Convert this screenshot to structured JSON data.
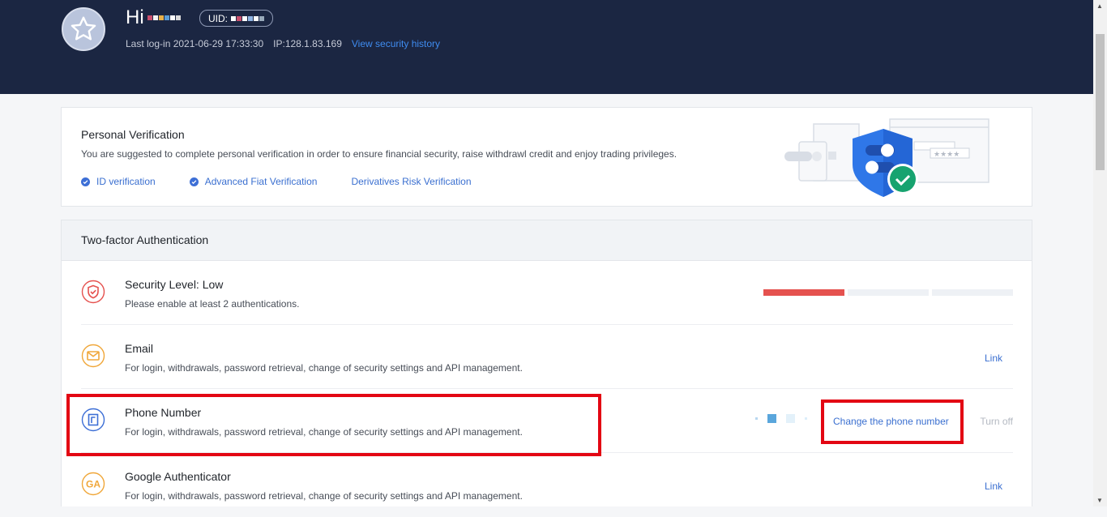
{
  "header": {
    "greeting": "Hi",
    "uid_label": "UID:",
    "last_login_label": "Last log-in 2021-06-29 17:33:30",
    "ip_label": "IP:128.1.83.169",
    "security_history_link": "View security history"
  },
  "personal_verification": {
    "title": "Personal Verification",
    "description": "You are suggested to complete personal verification in order to ensure financial security, raise withdrawl credit and enjoy trading privileges.",
    "links": [
      {
        "label": "ID verification",
        "completed": true
      },
      {
        "label": "Advanced Fiat Verification",
        "completed": true
      },
      {
        "label": "Derivatives Risk Verification",
        "completed": false
      }
    ]
  },
  "two_factor": {
    "title": "Two-factor Authentication",
    "security_level": {
      "title": "Security Level: Low",
      "description": "Please enable at least 2 authentications.",
      "segments_filled": 1,
      "segments_total": 3
    },
    "email": {
      "title": "Email",
      "description": "For login, withdrawals, password retrieval, change of security settings and API management.",
      "action": "Link"
    },
    "phone": {
      "title": "Phone Number",
      "description": "For login, withdrawals, password retrieval, change of security settings and API management.",
      "change_action": "Change the phone number",
      "turn_off_action": "Turn off"
    },
    "google_auth": {
      "title": "Google Authenticator",
      "description": "For login, withdrawals, password retrieval, change of security settings and API management.",
      "action": "Link",
      "icon_text": "GA"
    }
  },
  "colors": {
    "header_bg": "#1b2642",
    "link_blue": "#3a6fd0",
    "level_low_red": "#e5524f",
    "highlight_red": "#e30613",
    "email_icon": "#f0a73a",
    "phone_icon": "#3d6fd6"
  }
}
